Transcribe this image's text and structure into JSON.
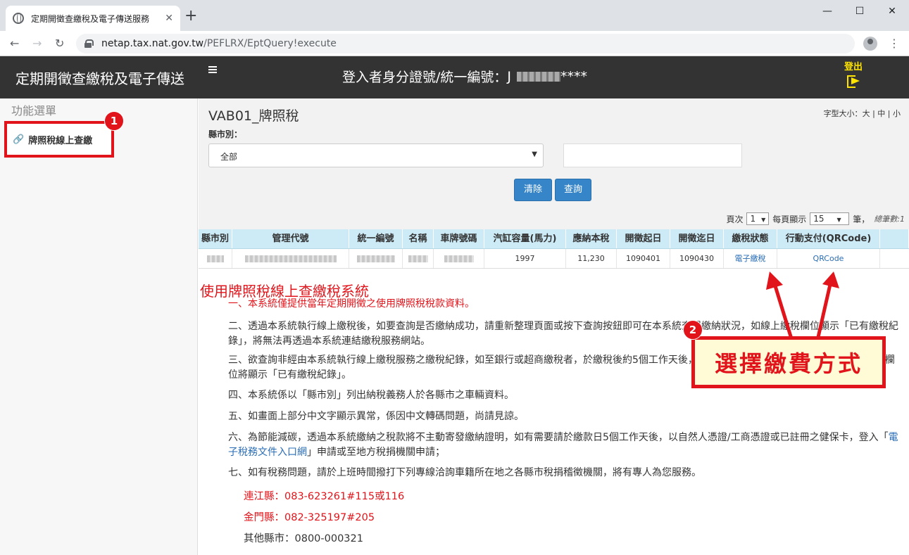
{
  "browser": {
    "tab_title": "定期開徵查繳稅及電子傳送服務",
    "tab_close": "✕",
    "new_tab": "+",
    "url_host": "netap.tax.nat.gov.tw",
    "url_path": "/PEFLRX/EptQuery!execute"
  },
  "header": {
    "app_name": "定期開徵查繳稅及電子傳送",
    "login_label": "登入者身分證號/統一編號：",
    "login_id_prefix": "J",
    "login_id_suffix": "****",
    "logout_label": "登出"
  },
  "sidebar": {
    "title": "功能選單",
    "items": [
      {
        "label": "牌照稅線上查繳"
      }
    ]
  },
  "main": {
    "page_title": "VAB01_牌照稅",
    "font_size": {
      "label": "字型大小：",
      "large": "大",
      "medium": "中",
      "small": "小",
      "sep": "|"
    },
    "county_label": "縣市別：",
    "county_value": "全部",
    "clear_button": "清除",
    "query_button": "查詢",
    "pager": {
      "page_label": "頁次",
      "page_value": "1",
      "per_page_label": "每頁顯示",
      "per_page_value": "15",
      "unit": "筆，",
      "total_label": "總筆數:",
      "total_value": "1"
    }
  },
  "table": {
    "headers": [
      "縣市別",
      "管理代號",
      "統一編號",
      "名稱",
      "車牌號碼",
      "汽缸容量(馬力)",
      "應納本稅",
      "開徵起日",
      "開徵迄日",
      "繳稅狀態",
      "行動支付(QRCode)"
    ],
    "row": {
      "cc": "1997",
      "tax": "11,230",
      "start": "1090401",
      "end": "1090430",
      "pay_status": "電子繳稅",
      "qrcode": "QRCode"
    }
  },
  "notes": {
    "title": "使用牌照稅線上查繳稅系統",
    "n1": "一、本系統僅提供當年定期開徵之使用牌照稅稅款資料。",
    "n2": "二、透過本系統執行線上繳稅後，如要查詢是否繳納成功，請重新整理頁面或按下查詢按鈕即可在本系統查得繳納狀況，如線上繳稅欄位顯示「已有繳稅紀錄」，將無法再透過本系統連結繳稅服務網站。",
    "n3": "三、欲查詢非經由本系統執行線上繳稅服務之繳稅紀錄，如至銀行或超商繳稅者，於繳稅後約5個工作天後，以自然人憑證或已註冊之健保卡，線上繳稅欄位將顯示「已有繳稅紀錄」。",
    "n4": "四、本系統係以「縣市別」列出納稅義務人於各縣市之車輛資料。",
    "n5": "五、如畫面上部分中文字顯示異常，係因中文轉碼問題，尚請見諒。",
    "n6_pre": "六、為節能減碳，透過本系統繳納之稅款將不主動寄發繳納證明，如有需要請於繳款日5個工作天後，以自然人憑證/工商憑證或已註冊之健保卡，登入「",
    "n6_link": "電子稅務文件入口網",
    "n6_post": "」申請或至地方稅捐機關申請；",
    "n7": "七、如有稅務問題，請於上班時間撥打下列專線洽詢車籍所在地之各縣市稅捐稽徵機關，將有專人為您服務。",
    "contacts": [
      {
        "text": "連江縣：083-623261#115或116",
        "color": "#e0141a"
      },
      {
        "text": "金門縣：082-325197#205",
        "color": "#e0141a"
      },
      {
        "text": "其他縣市：0800-000321",
        "color": "#333333"
      }
    ]
  },
  "annotations": {
    "badge1": "1",
    "badge2": "2",
    "callout": "選擇繳費方式",
    "accent_color": "#e0141a"
  }
}
